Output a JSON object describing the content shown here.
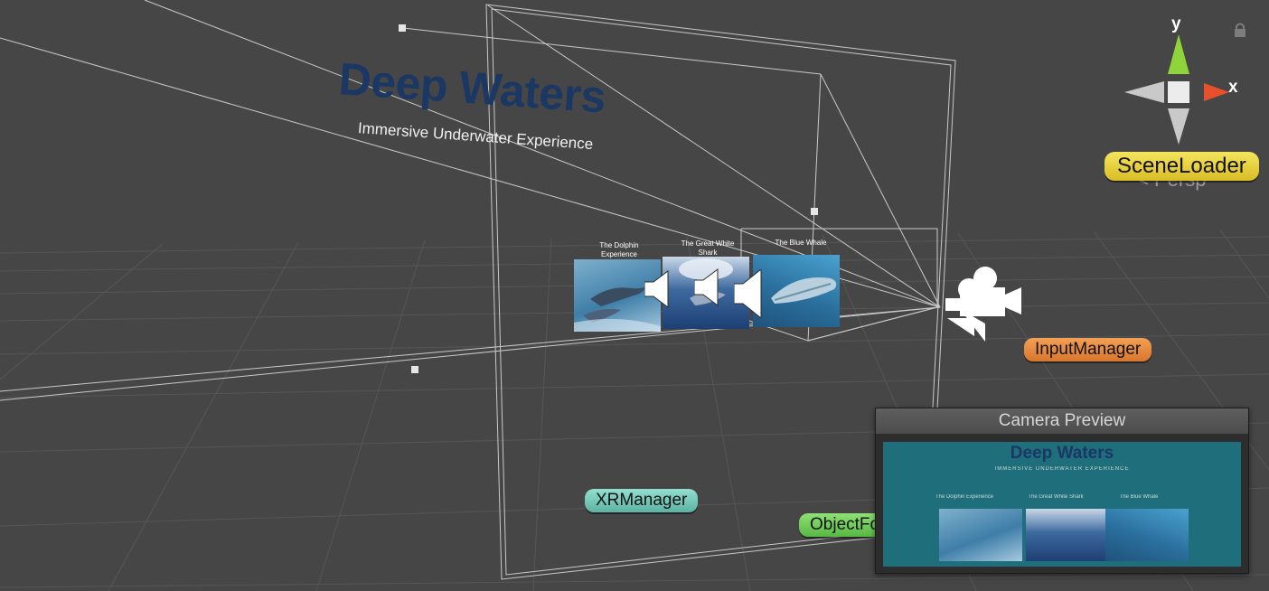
{
  "scene": {
    "title": "Deep Waters",
    "subtitle": "Immersive Underwater Experience",
    "cards": [
      {
        "caption": "The Dolphin Experience",
        "image": "dolphin"
      },
      {
        "caption": "The Great White Shark",
        "image": "shark"
      },
      {
        "caption": "The Blue Whale",
        "image": "whale"
      }
    ],
    "audio_icons": [
      "speaker-icon",
      "speaker-icon",
      "speaker-icon"
    ],
    "camera_icon": "movie-camera-icon"
  },
  "gizmo": {
    "y_label": "y",
    "x_label": "x",
    "persp_label": "Persp",
    "colors": {
      "y": "#8fd43b",
      "x": "#e8502c",
      "neutral": "#c9c9c9"
    }
  },
  "labels": {
    "scene_loader": "SceneLoader",
    "input_manager": "InputManager",
    "xr_manager": "XRManager",
    "object_partial": "ObjectFo"
  },
  "camera_preview": {
    "title": "Camera Preview",
    "view_title": "Deep Waters",
    "view_subtitle": "IMMERSIVE UNDERWATER EXPERIENCE",
    "card_captions": [
      "The Dolphin Experience",
      "The Great White Shark",
      "The Blue Whale"
    ]
  },
  "colors": {
    "background": "#464646",
    "title_text": "#1b3763",
    "preview_bg": "#1e6e7c",
    "scene_loader": "#e6cf3c",
    "input_manager": "#e58a3e",
    "xr_manager": "#76cbbb",
    "object_label": "#6fcc58"
  }
}
